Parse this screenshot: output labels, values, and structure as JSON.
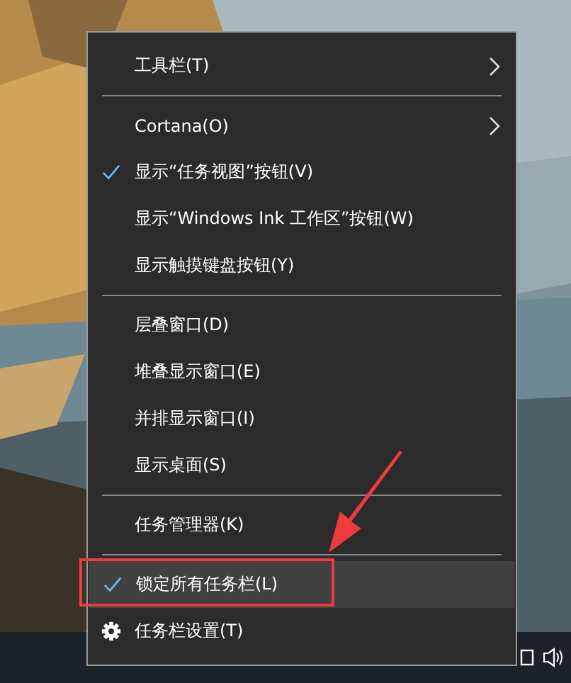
{
  "menu": {
    "items": [
      {
        "kind": "command",
        "label": "工具栏(T)",
        "submenu": true,
        "checked": false,
        "selected": false,
        "annotated": false
      },
      {
        "kind": "separator"
      },
      {
        "kind": "command",
        "label": "Cortana(O)",
        "submenu": true,
        "checked": false,
        "selected": false,
        "annotated": false
      },
      {
        "kind": "command",
        "label": "显示“任务视图”按钮(V)",
        "submenu": false,
        "checked": true,
        "selected": false,
        "annotated": false
      },
      {
        "kind": "command",
        "label": "显示“Windows Ink 工作区”按钮(W)",
        "submenu": false,
        "checked": false,
        "selected": false,
        "annotated": false
      },
      {
        "kind": "command",
        "label": "显示触摸键盘按钮(Y)",
        "submenu": false,
        "checked": false,
        "selected": false,
        "annotated": false
      },
      {
        "kind": "separator"
      },
      {
        "kind": "command",
        "label": "层叠窗口(D)",
        "submenu": false,
        "checked": false,
        "selected": false,
        "annotated": false
      },
      {
        "kind": "command",
        "label": "堆叠显示窗口(E)",
        "submenu": false,
        "checked": false,
        "selected": false,
        "annotated": false
      },
      {
        "kind": "command",
        "label": "并排显示窗口(I)",
        "submenu": false,
        "checked": false,
        "selected": false,
        "annotated": false
      },
      {
        "kind": "command",
        "label": "显示桌面(S)",
        "submenu": false,
        "checked": false,
        "selected": false,
        "annotated": false
      },
      {
        "kind": "separator"
      },
      {
        "kind": "command",
        "label": "任务管理器(K)",
        "submenu": false,
        "checked": false,
        "selected": false,
        "annotated": false
      },
      {
        "kind": "separator"
      },
      {
        "kind": "command",
        "label": "锁定所有任务栏(L)",
        "submenu": false,
        "checked": true,
        "selected": true,
        "annotated": true
      },
      {
        "kind": "settings",
        "label": "任务栏设置(T)",
        "submenu": false,
        "checked": false,
        "selected": false,
        "annotated": false
      }
    ]
  }
}
